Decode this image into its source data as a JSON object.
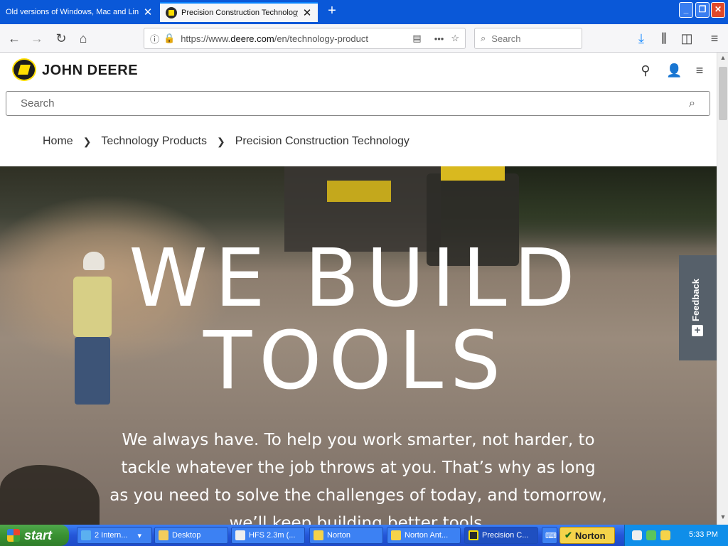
{
  "browser": {
    "tabs": [
      {
        "title": "Old versions of Windows, Mac and Linu",
        "active": false
      },
      {
        "title": "Precision Construction Technology",
        "active": true
      }
    ],
    "new_tab_icon": "+",
    "url_prefix": "https://www.",
    "url_domain": "deere.com",
    "url_path": "/en/technology-product",
    "search_placeholder": "Search"
  },
  "site": {
    "brand": "JOHN DEERE",
    "search_placeholder": "Search",
    "breadcrumb": [
      "Home",
      "Technology Products",
      "Precision Construction Technology"
    ]
  },
  "hero": {
    "title_line1": "WE BUILD",
    "title_line2": "TOOLS",
    "body": "We always have. To help you work smarter, not harder, to tackle whatever the job throws at you. That’s why as long as you need to solve the challenges of today, and tomorrow, we’ll keep building better tools."
  },
  "feedback": {
    "label": "Feedback",
    "plus": "+"
  },
  "taskbar": {
    "start_label": "start",
    "tasks": [
      {
        "label": "2 Intern..."
      },
      {
        "label": "Desktop"
      },
      {
        "label": "HFS 2.3m (..."
      },
      {
        "label": "Norton"
      },
      {
        "label": "Norton Ant..."
      },
      {
        "label": "Precision C..."
      }
    ],
    "norton_label": "Norton",
    "clock": "5:33 PM"
  },
  "colors": {
    "xp_blue": "#2456d8",
    "start_green": "#3a9132",
    "deere_yellow": "#ffde00",
    "feedback_gray": "#56606a"
  }
}
